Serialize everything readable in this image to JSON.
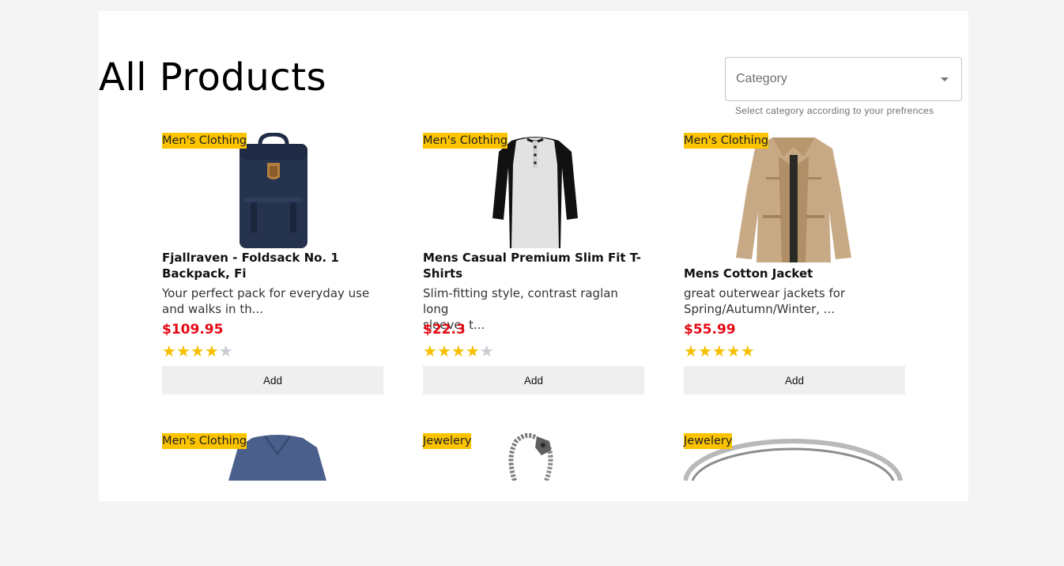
{
  "header": {
    "title": "All Products"
  },
  "filter": {
    "label": "Category",
    "helper": "Select category according to your prefrences"
  },
  "products": [
    {
      "category": "Men's Clothing",
      "title_line1": "Fjallraven - Foldsack No. 1",
      "title_line2": "Backpack, Fi",
      "desc_line1": "Your perfect pack for everyday use",
      "desc_line2": "and walks in th...",
      "price": "$109.95",
      "rating": 4,
      "button": "Add",
      "icon": "backpack"
    },
    {
      "category": "Men's Clothing",
      "title_line1": "Mens Casual Premium Slim Fit T-",
      "title_line2": "Shirts",
      "desc_line1": "Slim-fitting style, contrast raglan long",
      "desc_line2": "sleeve, t...",
      "price": "$22.3",
      "rating": 4,
      "button": "Add",
      "icon": "raglan-shirt"
    },
    {
      "category": "Men's Clothing",
      "title_line1": "Mens Cotton Jacket",
      "title_line2": "",
      "desc_line1": "great outerwear jackets for",
      "desc_line2": "Spring/Autumn/Winter, ...",
      "price": "$55.99",
      "rating": 5,
      "button": "Add",
      "icon": "jacket"
    },
    {
      "category": "Men's Clothing",
      "icon": "v-neck-shirt"
    },
    {
      "category": "Jewelery",
      "icon": "chain-bracelet"
    },
    {
      "category": "Jewelery",
      "icon": "silver-ring"
    }
  ]
}
